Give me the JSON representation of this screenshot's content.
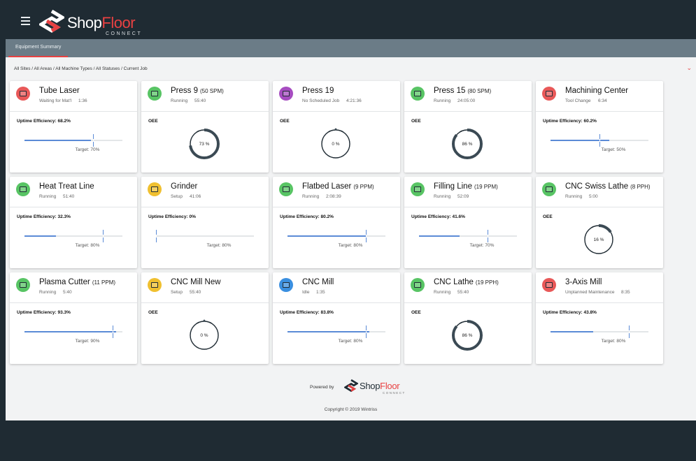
{
  "header": {
    "brand_part1": "Shop",
    "brand_part2": "Floor",
    "brand_sub": "CONNECT",
    "menu_icon": "hamburger-icon"
  },
  "tabs": [
    {
      "label": "Equipment Summary",
      "active": true
    }
  ],
  "breadcrumb": "All Sites / All Areas / All Machine Types / All Statuses / Current Job",
  "colors": {
    "brand_red": "#e84142",
    "topbar": "#1f2b33",
    "tabbar": "#6b7c87",
    "status_red": "#e85858",
    "status_green": "#58c464",
    "status_purple": "#a64cc0",
    "status_yellow": "#f0c030",
    "status_blue": "#3a8fe0",
    "bar": "#5b8bd6",
    "gauge": "#3b4a54"
  },
  "cards": [
    {
      "name": "Tube Laser",
      "rate": "",
      "status": "Waiting for Mat'l",
      "time": "1:36",
      "status_color": "#e85858",
      "icon": "laser-icon",
      "metric_type": "uptime",
      "metric_label": "Uptime Efficiency: 68.2%",
      "value": 68.2,
      "target_pct": 70,
      "target_label": "Target: 70%"
    },
    {
      "name": "Press 9",
      "rate": "(50 SPM)",
      "status": "Running",
      "time": "55:40",
      "status_color": "#58c464",
      "icon": "press-icon",
      "metric_type": "oee",
      "metric_label": "OEE",
      "value": 73,
      "value_label": "73 %"
    },
    {
      "name": "Press 19",
      "rate": "",
      "status": "No Scheduled Job",
      "time": "4:21:36",
      "status_color": "#a64cc0",
      "icon": "press-icon",
      "metric_type": "oee",
      "metric_label": "OEE",
      "value": 0,
      "value_label": "0 %"
    },
    {
      "name": "Press 15",
      "rate": "(80 SPM)",
      "status": "Running",
      "time": "24:05:00",
      "status_color": "#58c464",
      "icon": "press-icon",
      "metric_type": "oee",
      "metric_label": "OEE",
      "value": 86,
      "value_label": "86 %"
    },
    {
      "name": "Machining Center",
      "rate": "",
      "status": "Tool Change",
      "time": "6:34",
      "status_color": "#e85858",
      "icon": "machine-icon",
      "metric_type": "uptime",
      "metric_label": "Uptime Efficiency: 60.2%",
      "value": 60.2,
      "target_pct": 50,
      "target_label": "Target: 50%"
    },
    {
      "name": "Heat Treat Line",
      "rate": "",
      "status": "Running",
      "time": "51:40",
      "status_color": "#58c464",
      "icon": "furnace-icon",
      "metric_type": "uptime",
      "metric_label": "Uptime Efficiency: 32.3%",
      "value": 32.3,
      "target_pct": 80,
      "target_label": "Target: 80%"
    },
    {
      "name": "Grinder",
      "rate": "",
      "status": "Setup",
      "time": "41:06",
      "status_color": "#f0c030",
      "icon": "machine-icon",
      "metric_type": "uptime",
      "metric_label": "Uptime Efficiency: 0%",
      "value": 0,
      "target_pct": 0,
      "target_label": "Target: 80%"
    },
    {
      "name": "Flatbed Laser",
      "rate": "(9 PPM)",
      "status": "Running",
      "time": "2:08:39",
      "status_color": "#58c464",
      "icon": "laser-icon",
      "metric_type": "uptime",
      "metric_label": "Uptime Efficiency: 80.2%",
      "value": 80.2,
      "target_pct": 80,
      "target_label": "Target: 80%"
    },
    {
      "name": "Filling Line",
      "rate": "(19 PPM)",
      "status": "Running",
      "time": "52:09",
      "status_color": "#58c464",
      "icon": "filler-icon",
      "metric_type": "uptime",
      "metric_label": "Uptime Efficiency: 41.6%",
      "value": 41.6,
      "target_pct": 70,
      "target_label": "Target: 70%"
    },
    {
      "name": "CNC Swiss Lathe",
      "rate": "(8 PPH)",
      "status": "Running",
      "time": "5:00",
      "status_color": "#58c464",
      "icon": "lathe-icon",
      "metric_type": "oee",
      "metric_label": "OEE",
      "value": 16,
      "value_label": "16 %"
    },
    {
      "name": "Plasma Cutter",
      "rate": "(11 PPM)",
      "status": "Running",
      "time": "5:40",
      "status_color": "#58c464",
      "icon": "machine-icon",
      "metric_type": "uptime",
      "metric_label": "Uptime Efficiency: 93.3%",
      "value": 93.3,
      "target_pct": 90,
      "target_label": "Target: 90%"
    },
    {
      "name": "CNC Mill New",
      "rate": "",
      "status": "Setup",
      "time": "55:40",
      "status_color": "#f0c030",
      "icon": "machine-icon",
      "metric_type": "oee",
      "metric_label": "OEE",
      "value": 0,
      "value_label": "0 %"
    },
    {
      "name": "CNC Mill",
      "rate": "",
      "status": "Idle",
      "time": "1:35",
      "status_color": "#3a8fe0",
      "icon": "machine-icon",
      "metric_type": "uptime",
      "metric_label": "Uptime Efficiency: 83.8%",
      "value": 83.8,
      "target_pct": 80,
      "target_label": "Target: 80%"
    },
    {
      "name": "CNC Lathe",
      "rate": "(19 PPH)",
      "status": "Running",
      "time": "55:40",
      "status_color": "#58c464",
      "icon": "lathe-icon",
      "metric_type": "oee",
      "metric_label": "OEE",
      "value": 86,
      "value_label": "86 %"
    },
    {
      "name": "3-Axis Mill",
      "rate": "",
      "status": "Unplanned Maintenance",
      "time": "8:35",
      "status_color": "#e85858",
      "icon": "machine-icon",
      "metric_type": "uptime",
      "metric_label": "Uptime Efficiency: 43.8%",
      "value": 43.8,
      "target_pct": 80,
      "target_label": "Target: 80%"
    }
  ],
  "footer": {
    "powered_by": "Powered by",
    "brand_part1": "Shop",
    "brand_part2": "Floor",
    "brand_sub": "CONNECT",
    "copyright": "Copyright © 2019 Wintriss"
  }
}
